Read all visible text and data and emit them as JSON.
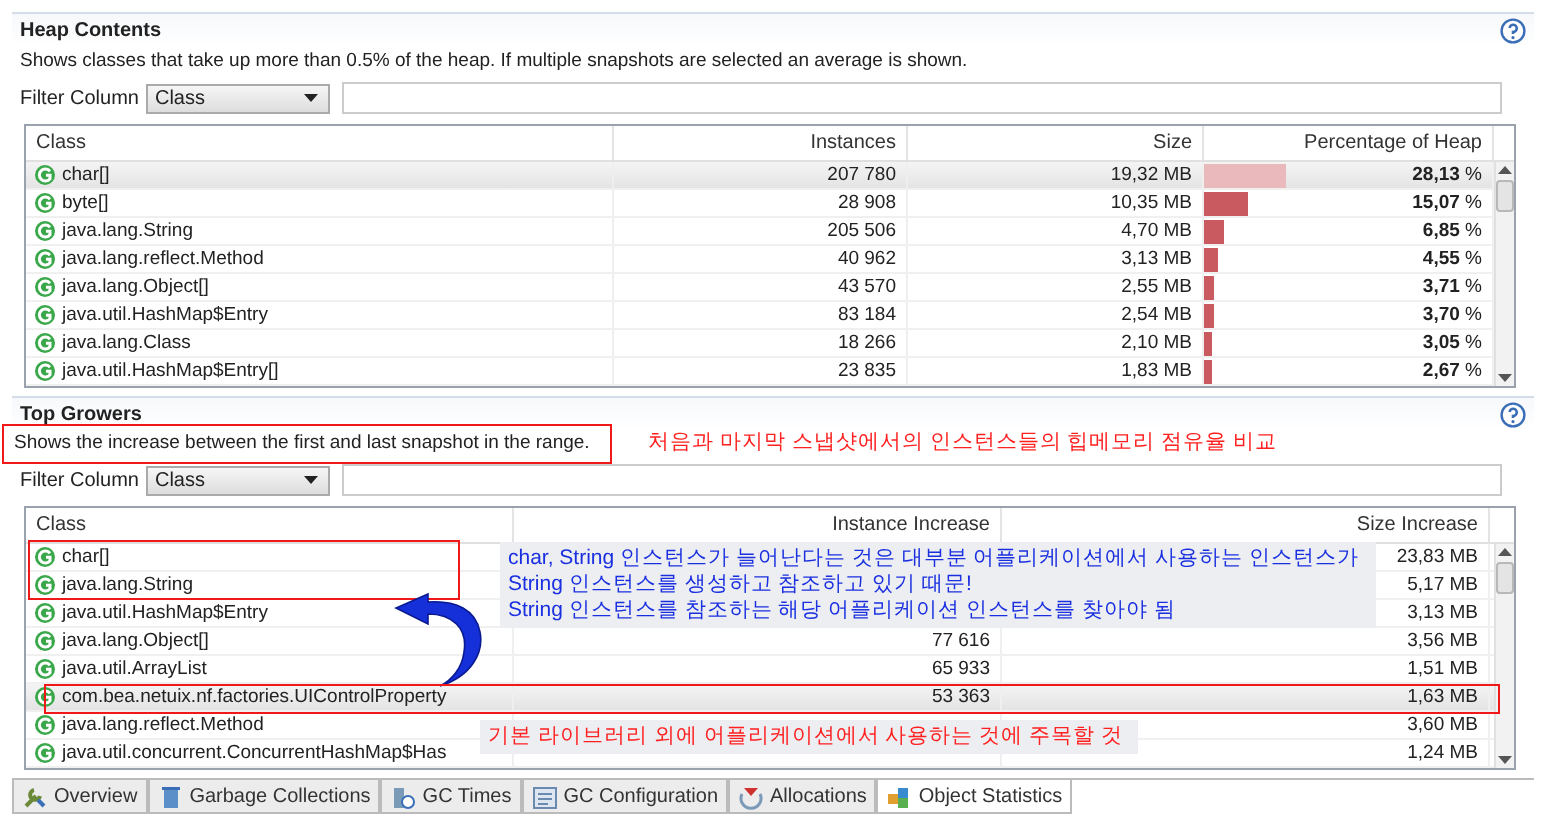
{
  "heap_contents": {
    "title": "Heap Contents",
    "description": "Shows classes that take up more than 0.5% of the heap. If multiple snapshots are selected an average is shown.",
    "filter": {
      "label": "Filter Column",
      "value": "Class"
    },
    "table": {
      "columns": [
        "Class",
        "Instances",
        "Size",
        "Percentage of Heap"
      ],
      "rows": [
        {
          "class": "char[]",
          "instances": "207 780",
          "size": "19,32 MB",
          "percentage": "**28,13** %",
          "level": 0.2813,
          "selected": true
        },
        {
          "class": "byte[]",
          "instances": "28 908",
          "size": "10,35 MB",
          "percentage": "**15,07** %",
          "level": 0.1507,
          "selected": false
        },
        {
          "class": "java.lang.String",
          "instances": "205 506",
          "size": "4,70 MB",
          "percentage": "**6,85** %",
          "level": 0.0685,
          "selected": false
        },
        {
          "class": "java.lang.reflect.Method",
          "instances": "40 962",
          "size": "3,13 MB",
          "percentage": "**4,55** %",
          "level": 0.0455,
          "selected": false
        },
        {
          "class": "java.lang.Object[]",
          "instances": "43 570",
          "size": "2,55 MB",
          "percentage": "**3,71** %",
          "level": 0.0371,
          "selected": false
        },
        {
          "class": "java.util.HashMap$Entry",
          "instances": "83 184",
          "size": "2,54 MB",
          "percentage": "**3,70** %",
          "level": 0.037,
          "selected": false
        },
        {
          "class": "java.lang.Class",
          "instances": "18 266",
          "size": "2,10 MB",
          "percentage": "**3,05** %",
          "level": 0.0305,
          "selected": false
        },
        {
          "class": "java.util.HashMap$Entry[]",
          "instances": "23 835",
          "size": "1,83 MB",
          "percentage": "**2,67** %",
          "level": 0.0267,
          "selected": false
        }
      ]
    }
  },
  "top_growers": {
    "title": "Top Growers",
    "description": "Shows the increase between the first and last snapshot in the range.",
    "filter": {
      "label": "Filter Column",
      "value": "Class"
    },
    "table": {
      "columns": [
        "Class",
        "Instance Increase",
        "Size Increase"
      ],
      "rows": [
        {
          "class": "char[]",
          "size_increase": "23,83 MB",
          "selected": false
        },
        {
          "class": "java.lang.String",
          "size_increase": "5,17 MB",
          "selected": false
        },
        {
          "class": "java.util.HashMap$Entry",
          "size_increase": "3,13 MB",
          "selected": false
        },
        {
          "class": "java.lang.Object[]",
          "instance_increase": "77 616",
          "size_increase": "3,56 MB",
          "selected": false
        },
        {
          "class": "java.util.ArrayList",
          "instance_increase": "65 933",
          "size_increase": "1,51 MB",
          "selected": false
        },
        {
          "class": "com.bea.netuix.nf.factories.UIControlProperty",
          "instance_increase": "53 363",
          "size_increase": "1,63 MB",
          "selected": true
        },
        {
          "class": "java.lang.reflect.Method",
          "size_increase": "3,60 MB",
          "selected": false
        },
        {
          "class": "java.util.concurrent.ConcurrentHashMap$Has",
          "size_increase": "1,24 MB",
          "selected": false
        }
      ]
    }
  },
  "annotations": [
    {
      "kind": "frame"
    },
    {
      "kind": "caption",
      "text": "처음과 마지막 스냅샷에서의 인스턴스들의 힙메모리 점유율 비교",
      "color": "#ff2020"
    },
    {
      "kind": "frame"
    },
    {
      "kind": "callout",
      "lines": [
        "char, String 인스턴스가 늘어난다는 것은 대부분 어플리케이션에서 사용하는 인스턴스가",
        "String 인스턴스를 생성하고 참조하고 있기 때문!",
        "String 인스턴스를 참조하는 해당 어플리케이션 인스턴스를 찾아야 됨"
      ],
      "color": "#1a2fe0"
    },
    {
      "kind": "arrow"
    },
    {
      "kind": "frame"
    },
    {
      "kind": "callout",
      "lines": [
        "기본 라이브러리 외에 어플리케이션에서 사용하는 것에 주목할 것"
      ],
      "color": "#ff2020"
    }
  ],
  "tabs": [
    {
      "label": "Overview",
      "selected": false
    },
    {
      "label": "Garbage Collections",
      "selected": false
    },
    {
      "label": "GC Times",
      "selected": false
    },
    {
      "label": "GC Configuration",
      "selected": false
    },
    {
      "label": "Allocations",
      "selected": false
    },
    {
      "label": "Object Statistics",
      "selected": true
    }
  ]
}
